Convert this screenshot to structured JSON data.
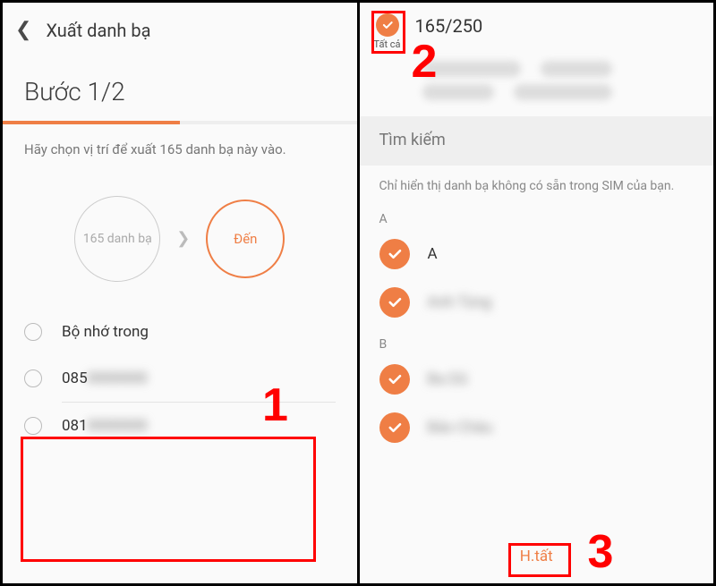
{
  "left": {
    "header_title": "Xuất danh bạ",
    "step": "Bước 1/2",
    "instruction": "Hãy chọn vị trí để xuất 165 danh bạ này vào.",
    "source_circle": "165 danh bạ",
    "dest_circle": "Đến",
    "options": [
      {
        "label": "Bộ nhớ trong"
      },
      {
        "label_prefix": "085",
        "label_blur": "0000000"
      },
      {
        "label_prefix": "081",
        "label_blur": "0000000"
      }
    ]
  },
  "right": {
    "select_all_label": "Tất cả",
    "count": "165/250",
    "search_label": "Tìm kiếm",
    "sim_note": "Chỉ hiển thị danh bạ không có sẵn trong SIM của bạn.",
    "sections": [
      {
        "letter": "A",
        "contacts": [
          {
            "name": "A",
            "blurred": false
          },
          {
            "name": "Anh Tùng",
            "blurred": true
          }
        ]
      },
      {
        "letter": "B",
        "contacts": [
          {
            "name": "Ba Dũ",
            "blurred": true
          },
          {
            "name": "Bảo Châu",
            "blurred": true
          }
        ]
      }
    ],
    "done_label": "H.tất"
  },
  "annotations": {
    "n1": "1",
    "n2": "2",
    "n3": "3"
  }
}
